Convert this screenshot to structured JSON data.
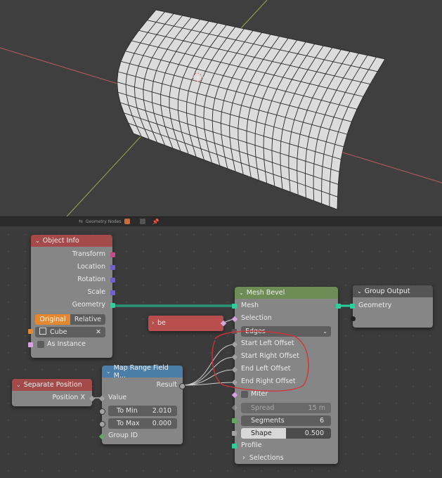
{
  "editor_header": {
    "editor_name": "Geometry Nodes"
  },
  "colors": {
    "object_info_header": "#a44a4a",
    "mesh_bevel_header": "#6e8c55",
    "group_output_header": "#555555",
    "map_range_header": "#4a7ea8",
    "separate_header": "#a44a4a",
    "geometry_socket": "#2fcf9c",
    "vector_socket": "#6f5fd6",
    "float_socket": "#a1a1a1",
    "bool_socket": "#d6a3e0",
    "object_socket": "#e0883a",
    "annotation": "#d43232"
  },
  "object_info": {
    "title": "Object Info",
    "outputs": [
      "Transform",
      "Location",
      "Rotation",
      "Scale",
      "Geometry"
    ],
    "mode_original": "Original",
    "mode_relative": "Relative",
    "object_value": "Cube",
    "as_instance": "As Instance"
  },
  "be_node": {
    "title": "be"
  },
  "mesh_bevel": {
    "title": "Mesh Bevel",
    "mesh": "Mesh",
    "selection": "Selection",
    "mode": "Edges",
    "start_left_offset": "Start Left Offset",
    "start_right_offset": "Start Right Offset",
    "end_left_offset": "End Left Offset",
    "end_right_offset": "End Right Offset",
    "miter": "Miter",
    "spread_label": "Spread",
    "spread_value": "15 m",
    "segments_label": "Segments",
    "segments_value": "6",
    "shape_label": "Shape",
    "shape_value": "0.500",
    "profile": "Profile",
    "selections": "Selections"
  },
  "group_output": {
    "title": "Group Output",
    "geometry": "Geometry"
  },
  "map_range": {
    "title": "Map Range Field M...",
    "result": "Result",
    "value": "Value",
    "to_min_label": "To Min",
    "to_min_value": "2.010",
    "to_max_label": "To Max",
    "to_max_value": "0.000",
    "group_id": "Group ID"
  },
  "separate_position": {
    "title": "Separate Position",
    "position_x": "Position X"
  }
}
